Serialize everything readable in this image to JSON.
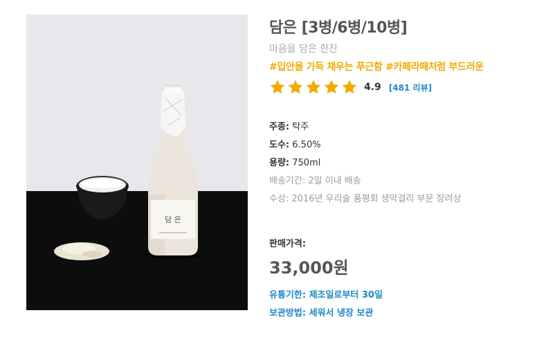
{
  "product": {
    "title": "담은 [3병/6병/10병]",
    "subtitle": "마음을 담은 한잔",
    "tags": "#입안을 가득 채우는 푸근함 #카페라떼처럼 부드러운",
    "rating": {
      "stars": 5,
      "score": "4.9",
      "review_link": "[481 리뷰]",
      "star_color": "#f5a800"
    },
    "specs": [
      {
        "key": "주종:",
        "value": "탁주"
      },
      {
        "key": "도수:",
        "value": "6.50%"
      },
      {
        "key": "용량:",
        "value": "750ml"
      },
      {
        "key": "배송기간:",
        "value": "2일 이내 배송"
      },
      {
        "key": "수상:",
        "value": "2016년 우리술 품평회 생막걸리 부문 장려상"
      }
    ],
    "price_label": "판매가격:",
    "price": "33,000원",
    "expiry": {
      "key": "유통기한:",
      "value": "제조일로부터 30일"
    },
    "storage": {
      "key": "보관방법:",
      "value": "세워서 냉장 보관"
    },
    "bottle_label": "담 은",
    "colors": {
      "accent_blue": "#1e88c8",
      "tag_yellow": "#f2a900"
    }
  }
}
